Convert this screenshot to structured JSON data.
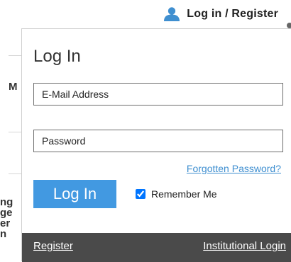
{
  "header": {
    "login_register_label": "Log in / Register",
    "user_icon": "user-icon"
  },
  "background": {
    "letters": [
      "M",
      "ng",
      "ge",
      "er",
      "n"
    ]
  },
  "login_panel": {
    "title": "Log In",
    "email_placeholder": "E-Mail Address",
    "password_placeholder": "Password",
    "forgot_password_label": "Forgotten Password?",
    "login_button_label": "Log In",
    "remember_me_label": "Remember Me",
    "remember_me_checked": true,
    "colors": {
      "primary_button": "#4299e1",
      "link": "#3f8fd0",
      "footer_bg": "#4a4a4a"
    }
  },
  "footer": {
    "register_label": "Register",
    "institutional_login_label": "Institutional Login"
  }
}
